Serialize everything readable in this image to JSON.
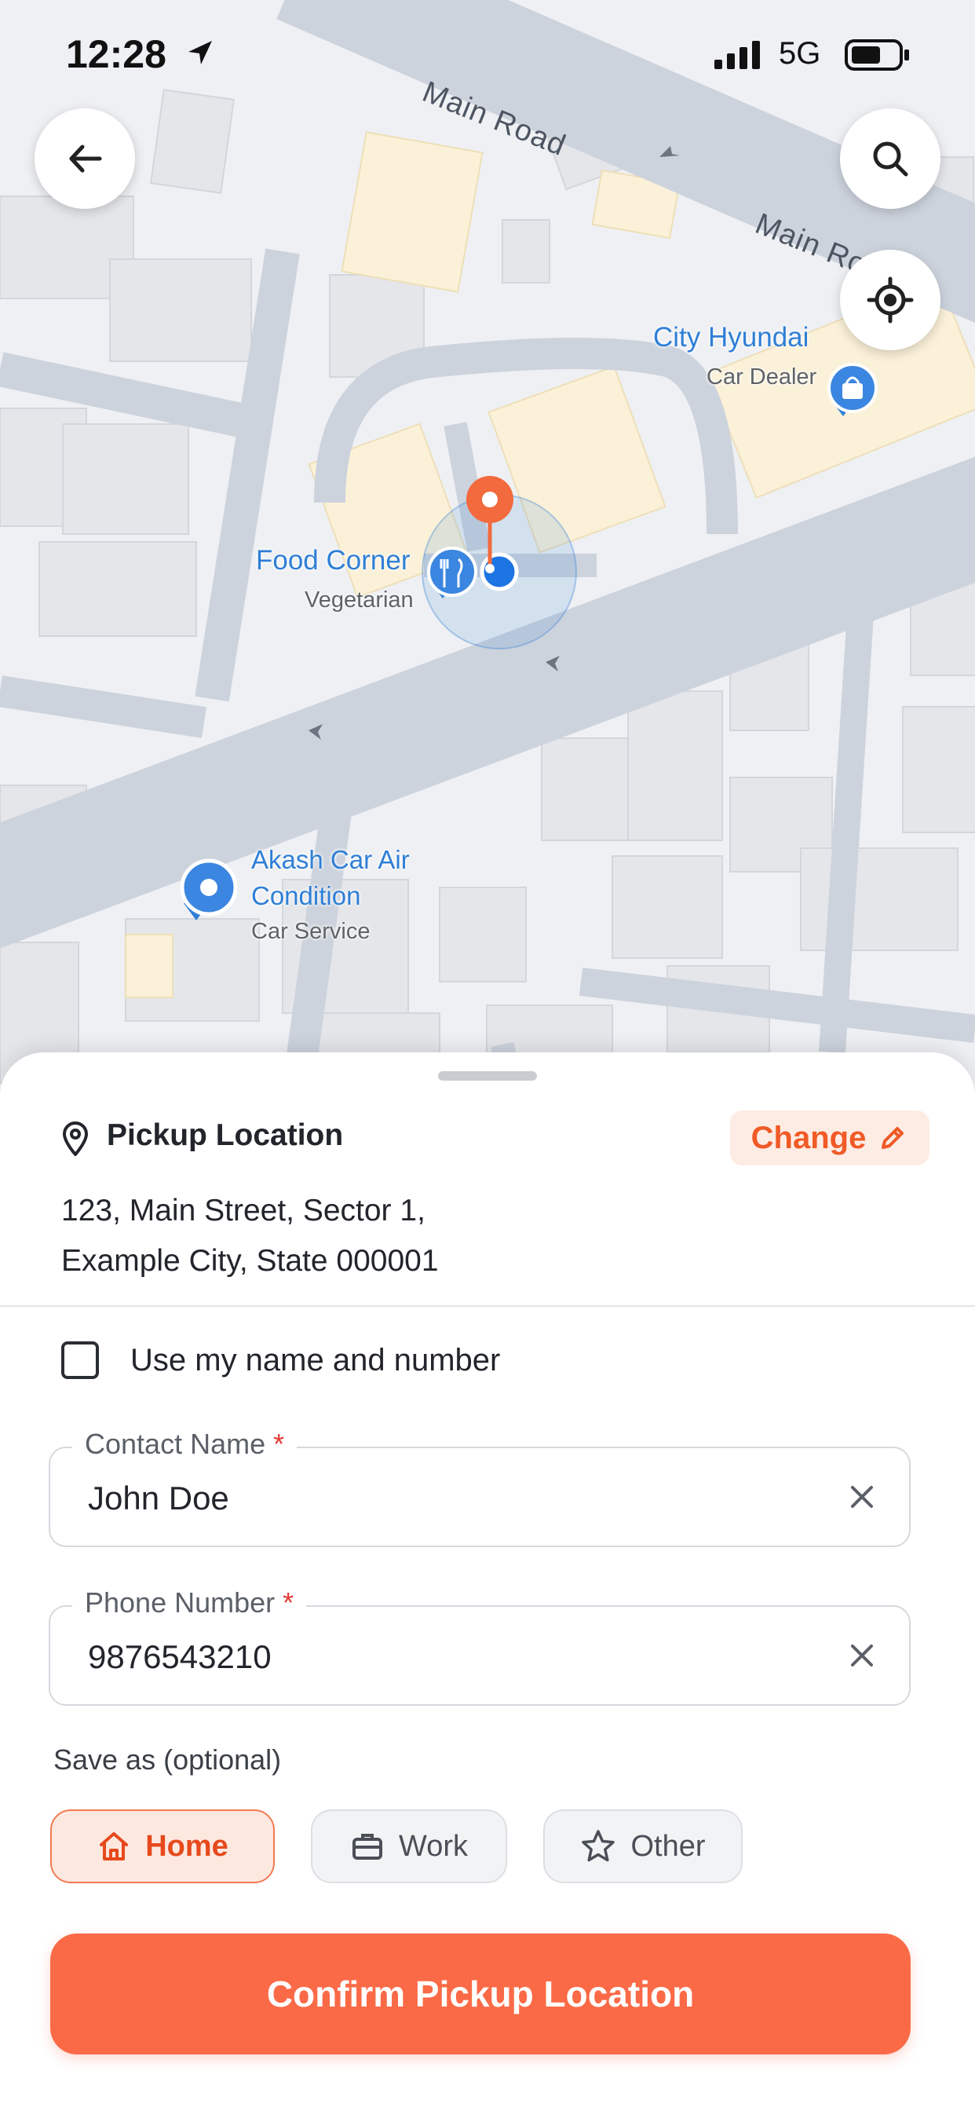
{
  "status_bar": {
    "time": "12:28",
    "network": "5G"
  },
  "map": {
    "roads": [
      "Main Road",
      "Main Ro"
    ],
    "pois": [
      {
        "name": "City Hyundai",
        "category": "Car Dealer"
      },
      {
        "name": "Food Corner",
        "category": "Vegetarian"
      },
      {
        "name": "Akash Car Air",
        "name_line2": "Condition",
        "category": "Car Service"
      }
    ]
  },
  "pickup": {
    "title": "Pickup Location",
    "change_label": "Change",
    "address_line1": "123, Main Street, Sector 1,",
    "address_line2": "Example City, State 000001"
  },
  "form": {
    "use_my_details_label": "Use my name and number",
    "use_my_details_checked": false,
    "contact_name": {
      "label": "Contact Name",
      "required_mark": "*",
      "value": "John Doe"
    },
    "phone_number": {
      "label": "Phone Number",
      "required_mark": "*",
      "value": "9876543210"
    },
    "save_as_label": "Save as (optional)",
    "save_as_options": [
      {
        "label": "Home",
        "icon": "home-icon",
        "selected": true
      },
      {
        "label": "Work",
        "icon": "briefcase-icon",
        "selected": false
      },
      {
        "label": "Other",
        "icon": "star-icon",
        "selected": false
      }
    ]
  },
  "confirm_label": "Confirm Pickup Location",
  "colors": {
    "accent": "#fb6a47",
    "accent_text": "#f05a27",
    "map_blue": "#2f7fd6",
    "pin_orange": "#f26a3d"
  }
}
